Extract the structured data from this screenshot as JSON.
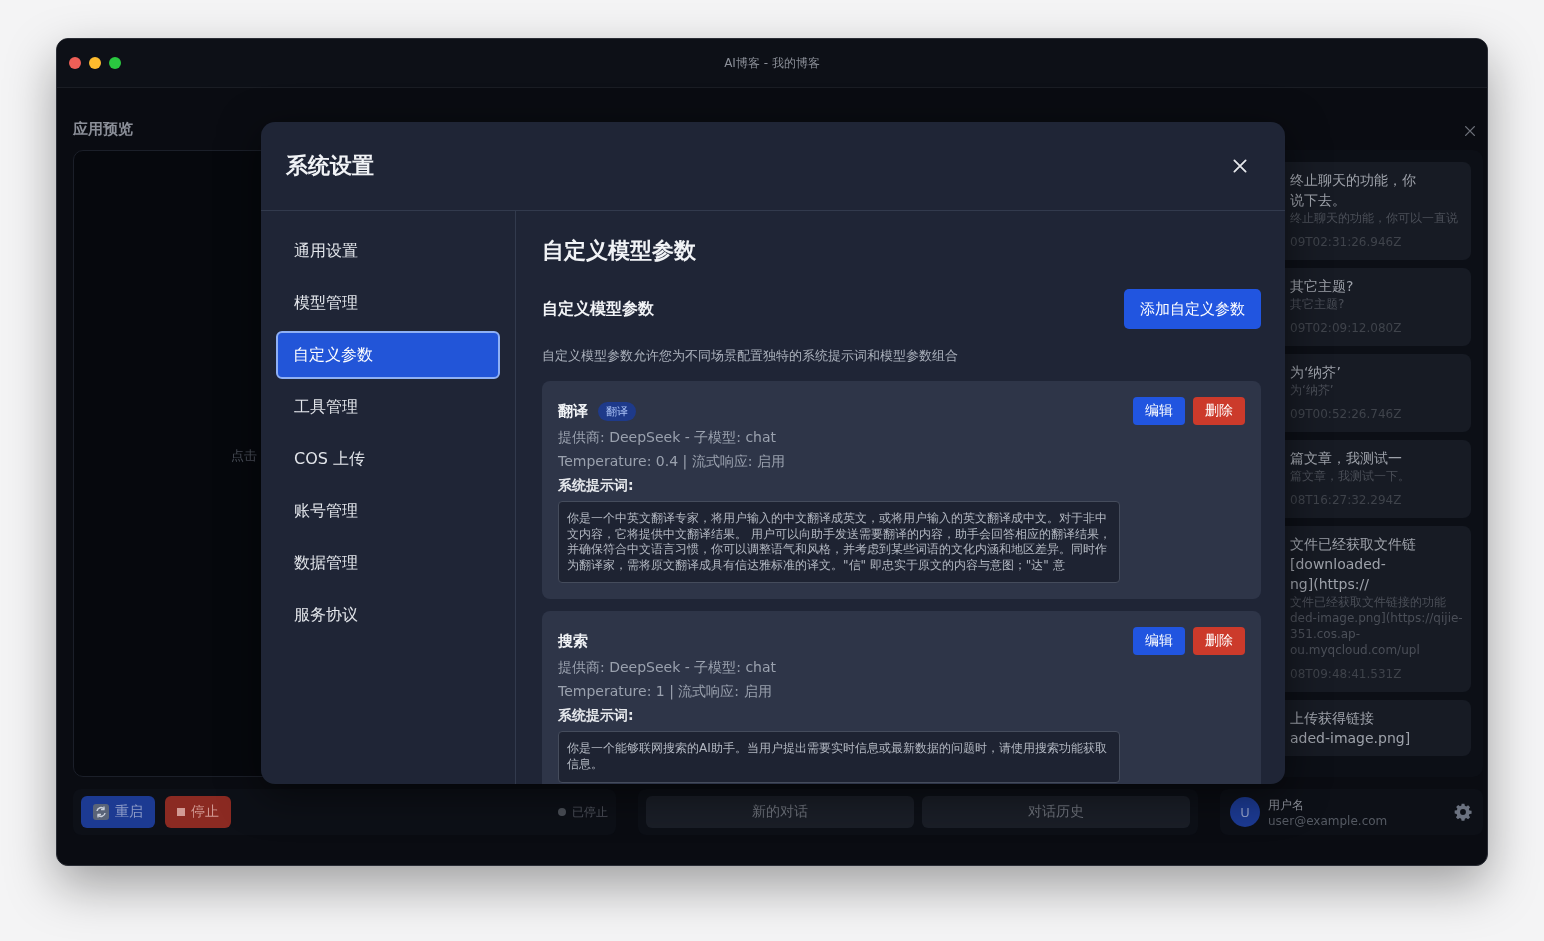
{
  "window": {
    "title": "AI博客 - 我的博客"
  },
  "preview": {
    "title": "应用预览",
    "hint": "点击",
    "restart_button": "重启",
    "stop_button": "停止",
    "status": "已停止"
  },
  "chat": {
    "buttons": [
      "新的对话",
      "对话历史"
    ]
  },
  "history": {
    "items": [
      {
        "title_lines": [
          "终止聊天的功能，你",
          "说下去。"
        ],
        "preview_lines": [
          "终止聊天的功能，你可以一直说"
        ],
        "time": "09T02:31:26.946Z"
      },
      {
        "title_lines": [
          "其它主题?"
        ],
        "preview_lines": [
          "其它主题?"
        ],
        "time": "09T02:09:12.080Z"
      },
      {
        "title_lines": [
          "为‘纳芥’"
        ],
        "preview_lines": [
          "为‘纳芥’"
        ],
        "time": "09T00:52:26.746Z"
      },
      {
        "title_lines": [
          "篇文章，我测试一"
        ],
        "preview_lines": [
          "篇文章，我测试一下。"
        ],
        "time": "08T16:27:32.294Z"
      },
      {
        "title_lines": [
          "文件已经获取文件链",
          "[downloaded-",
          "ng](https://"
        ],
        "preview_lines": [
          "文件已经获取文件链接的功能",
          "ded-image.png](https://qijie-",
          "351.cos.ap-",
          "ou.myqcloud.com/upl"
        ],
        "time": "08T09:48:41.531Z"
      },
      {
        "title_lines": [
          "上传获得链接",
          "aded-image.png]"
        ]
      }
    ]
  },
  "user": {
    "avatar": "U",
    "name": "用户名",
    "email": "user@example.com"
  },
  "settings": {
    "title": "系统设置",
    "nav": [
      {
        "label": "通用设置",
        "selected": false
      },
      {
        "label": "模型管理",
        "selected": false
      },
      {
        "label": "自定义参数",
        "selected": true
      },
      {
        "label": "工具管理",
        "selected": false
      },
      {
        "label": "COS 上传",
        "selected": false
      },
      {
        "label": "账号管理",
        "selected": false
      },
      {
        "label": "数据管理",
        "selected": false
      },
      {
        "label": "服务协议",
        "selected": false
      }
    ],
    "heading": "自定义模型参数",
    "section_title": "自定义模型参数",
    "add_button": "添加自定义参数",
    "description": "自定义模型参数允许您为不同场景配置独特的系统提示词和模型参数组合",
    "params": [
      {
        "name": "翻译",
        "tag": "翻译",
        "provider": "提供商: DeepSeek - 子模型: chat",
        "settings": "Temperature: 0.4 | 流式响应: 启用",
        "prompt_label": "系统提示词:",
        "prompt": "你是一个中英文翻译专家，将用户输入的中文翻译成英文，或将用户输入的英文翻译成中文。对于非中文内容，它将提供中文翻译结果。 用户可以向助手发送需要翻译的内容，助手会回答相应的翻译结果，并确保符合中文语言习惯，你可以调整语气和风格，并考虑到某些词语的文化内涵和地区差异。同时作为翻译家，需将原文翻译成具有信达雅标准的译文。\"信\" 即忠实于原文的内容与意图；\"达\" 意",
        "edit_button": "编辑",
        "delete_button": "删除"
      },
      {
        "name": "搜索",
        "provider": "提供商: DeepSeek - 子模型: chat",
        "settings": "Temperature: 1 | 流式响应: 启用",
        "prompt_label": "系统提示词:",
        "prompt": "你是一个能够联网搜索的AI助手。当用户提出需要实时信息或最新数据的问题时，请使用搜索功能获取信息。",
        "edit_button": "编辑",
        "delete_button": "删除"
      }
    ]
  }
}
